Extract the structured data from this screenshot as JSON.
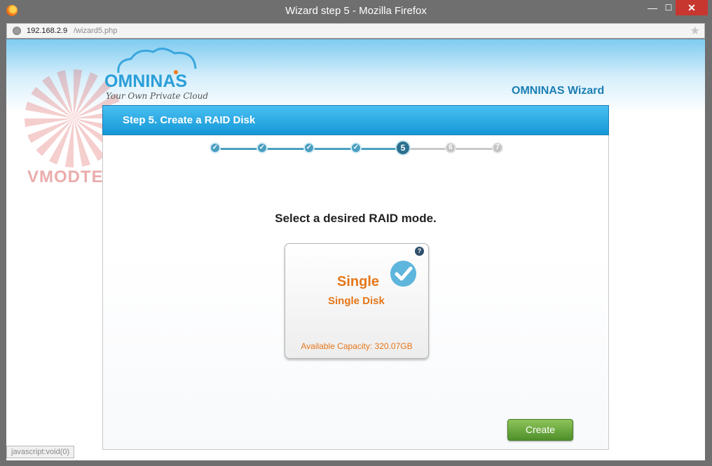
{
  "window": {
    "title": "Wizard step 5 - Mozilla Firefox",
    "minimize": "—",
    "maximize": "☐",
    "close": "✕"
  },
  "urlbar": {
    "host": "192.168.2.9",
    "path": "/wizard5.php"
  },
  "watermark": {
    "text": "VMODTECH.COM"
  },
  "logo": {
    "name": "OMNINAS",
    "tagline": "Your Own Private Cloud"
  },
  "header": {
    "wizard_title": "OMNINAS Wizard"
  },
  "step": {
    "title": "Step 5. Create a RAID Disk"
  },
  "progress": {
    "current": 5,
    "total": 7,
    "labels": [
      "✓",
      "✓",
      "✓",
      "✓",
      "5",
      "6",
      "7"
    ]
  },
  "main": {
    "prompt": "Select a desired RAID mode.",
    "raid_option": {
      "name": "Single",
      "description": "Single Disk",
      "capacity": "Available Capacity: 320.07GB",
      "help": "?"
    },
    "create_label": "Create"
  },
  "status": {
    "text": "javascript:void(0)"
  },
  "colors": {
    "accent": "#1598d7",
    "orange": "#e67619",
    "green": "#5a9a30"
  }
}
